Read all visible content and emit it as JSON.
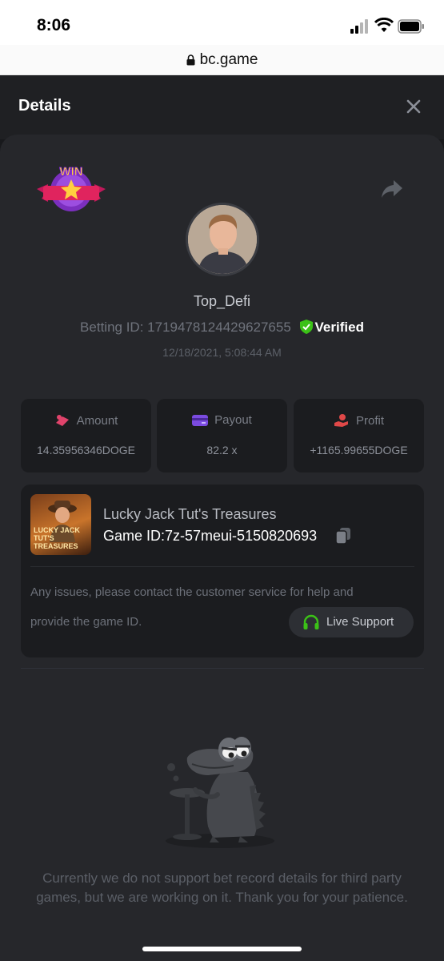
{
  "status_bar": {
    "time": "8:06"
  },
  "browser": {
    "url": "bc.game"
  },
  "header": {
    "title": "Details"
  },
  "bet": {
    "badge_text": "WIN",
    "username": "Top_Defi",
    "betting_id_label": "Betting ID:",
    "betting_id": "1719478124429627655",
    "verified_label": "Verified",
    "date": "12/18/2021, 5:08:44 AM"
  },
  "stats": [
    {
      "label": "Amount",
      "value": "14.35956346DOGE",
      "icon": "amount-icon",
      "color": "#e0436b"
    },
    {
      "label": "Payout",
      "value": "82.2 x",
      "icon": "payout-icon",
      "color": "#7b4be0"
    },
    {
      "label": "Profit",
      "value": "+1165.99655DOGE",
      "icon": "profit-icon",
      "color": "#e04848"
    }
  ],
  "game": {
    "thumb_text": "LUCKY JACK TUT'S TREASURES",
    "name": "Lucky Jack Tut's Treasures",
    "game_id": "Game ID:7z-57meui-5150820693",
    "issue_line1": "Any issues, please contact the customer service for help and",
    "issue_line2": "provide the game ID.",
    "support_label": "Live Support"
  },
  "empty_message": "Currently we do not support bet record details for third party games, but we are working on it. Thank you for your patience.",
  "colors": {
    "background": "#26272b",
    "card": "#1b1c1f",
    "verified": "#3bc117",
    "support_icon": "#3bc117"
  }
}
